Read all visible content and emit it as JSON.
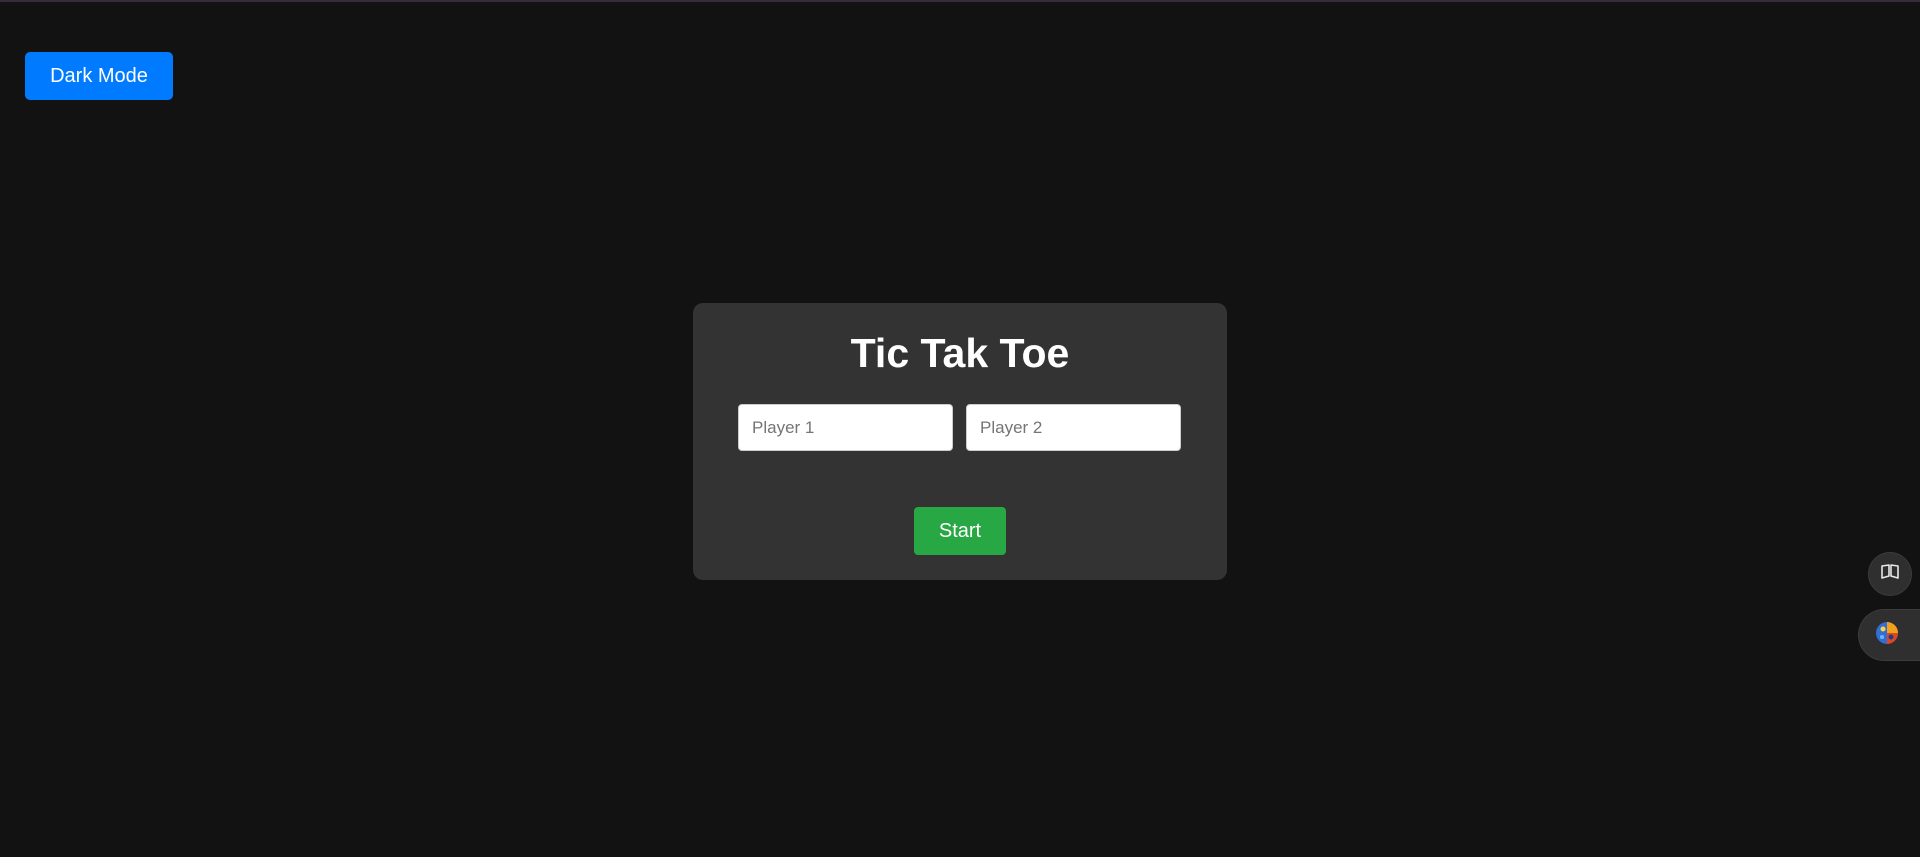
{
  "header": {
    "mode_button_label": "Dark Mode"
  },
  "game": {
    "title": "Tic Tak Toe",
    "player1": {
      "value": "",
      "placeholder": "Player 1"
    },
    "player2": {
      "value": "",
      "placeholder": "Player 2"
    },
    "start_label": "Start"
  },
  "side_toolbar": {
    "items": [
      {
        "icon": "book-icon"
      },
      {
        "icon": "extension-icon"
      }
    ]
  },
  "colors": {
    "background": "#121212",
    "card": "#333333",
    "mode_button": "#007bff",
    "start_button": "#28a745",
    "text": "#ffffff"
  }
}
